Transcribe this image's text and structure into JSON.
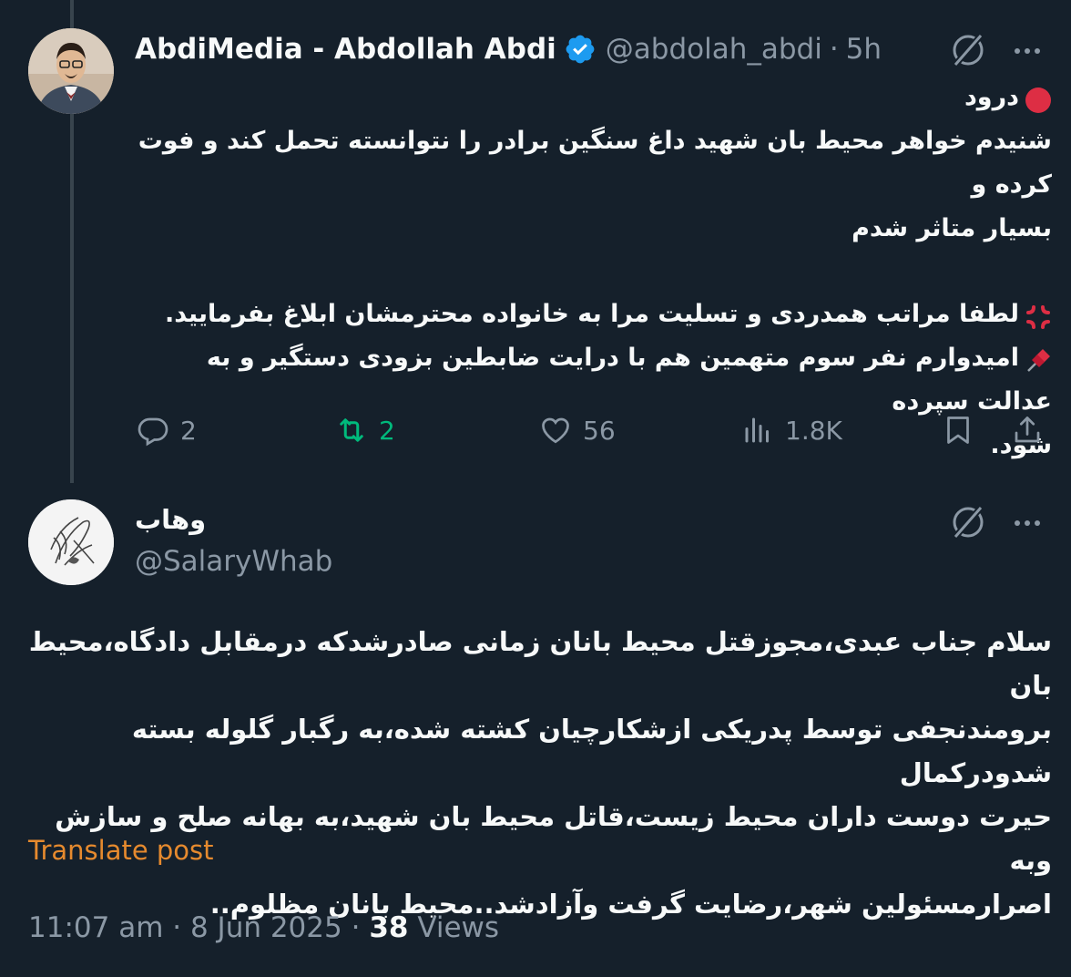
{
  "tweet1": {
    "display_name": "AbdiMedia - Abdollah Abdi",
    "handle": "@abdolah_abdi",
    "separator": "·",
    "time": "5h",
    "lines": [
      "درود",
      "شنیدم خواهر محیط بان شهید داغ سنگین برادر را نتوانسته تحمل کند و فوت کرده و",
      "بسیار متاثر شدم",
      "لطفا مراتب همدردی و تسلیت مرا به خانواده محترمشان ابلاغ بفرمایید.",
      "امیدوارم نفر سوم متهمین هم با درایت ضابطین بزودی دستگیر و به عدالت سپرده",
      "شود."
    ],
    "line_icons": [
      "red-circle-icon",
      "anger-icon",
      "pushpin-icon"
    ],
    "actions": {
      "replies": "2",
      "retweets": "2",
      "likes": "56",
      "views": "1.8K"
    }
  },
  "tweet2": {
    "display_name": "وهاب",
    "handle": "@SalaryWhab",
    "lines": [
      "سلام جناب عبدی،مجوزقتل محیط بانان زمانی صادرشدکه درمقابل دادگاه،محیط بان",
      "برومندنجفی توسط پدریکی ازشکارچیان کشته شده،به رگبار گلوله بسته شدودرکمال",
      "حیرت دوست داران محیط زیست،قاتل محیط بان شهید،به بهانه صلح و سازش وبه",
      "اصرارمسئولین شهر،رضایت گرفت وآزادشد..محیط بانان مظلوم.."
    ],
    "translate_label": "Translate post",
    "timestamp": "11:07 am",
    "date": "8 Jun 2025",
    "separator": "·",
    "views_count": "38",
    "views_label": "Views"
  },
  "colors": {
    "background": "#15202b",
    "text": "#f7f9f9",
    "muted": "#8b98a5",
    "verified": "#1d9bf0",
    "retweet_active": "#00ba7c",
    "translate": "#e68a2e",
    "thread_line": "#38444d"
  }
}
